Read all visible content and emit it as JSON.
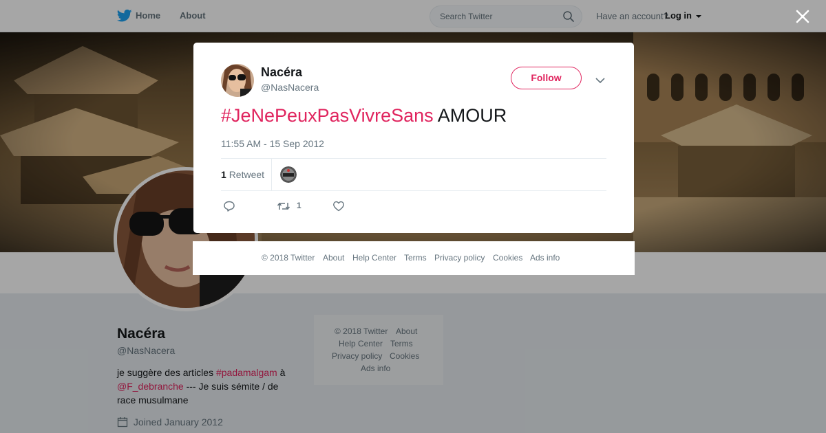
{
  "topbar": {
    "home_label": "Home",
    "about_label": "About",
    "search_placeholder": "Search Twitter",
    "have_account": "Have an account?",
    "login_label": "Log in"
  },
  "profile": {
    "name": "Nacéra",
    "handle": "@NasNacera",
    "bio_part1": "je suggère des articles ",
    "bio_hashtag": "#padamalgam",
    "bio_part2": " à",
    "bio_mention": "@F_debranche",
    "bio_part3": " --- Je suis sémite / de race musulmane",
    "joined": "Joined January 2012"
  },
  "tweet": {
    "author_name": "Nacéra",
    "author_handle": "@NasNacera",
    "follow_label": "Follow",
    "hashtag": "#JeNePeuxPasVivreSans",
    "text": " AMOUR",
    "timestamp": "11:55 AM - 15 Sep 2012",
    "retweet_count": "1",
    "retweet_label": "Retweet",
    "action_retweet_count": "1"
  },
  "modal_footer": {
    "copyright": "© 2018 Twitter",
    "about": "About",
    "help": "Help Center",
    "terms": "Terms",
    "privacy": "Privacy policy",
    "cookies": "Cookies",
    "ads": "Ads info"
  },
  "side_footer": {
    "copyright": "© 2018 Twitter",
    "about": "About",
    "help": "Help Center",
    "terms": "Terms",
    "privacy": "Privacy policy",
    "cookies": "Cookies",
    "ads": "Ads info"
  },
  "colors": {
    "brand_blue": "#1da1f2",
    "accent_red": "#e0245e"
  }
}
